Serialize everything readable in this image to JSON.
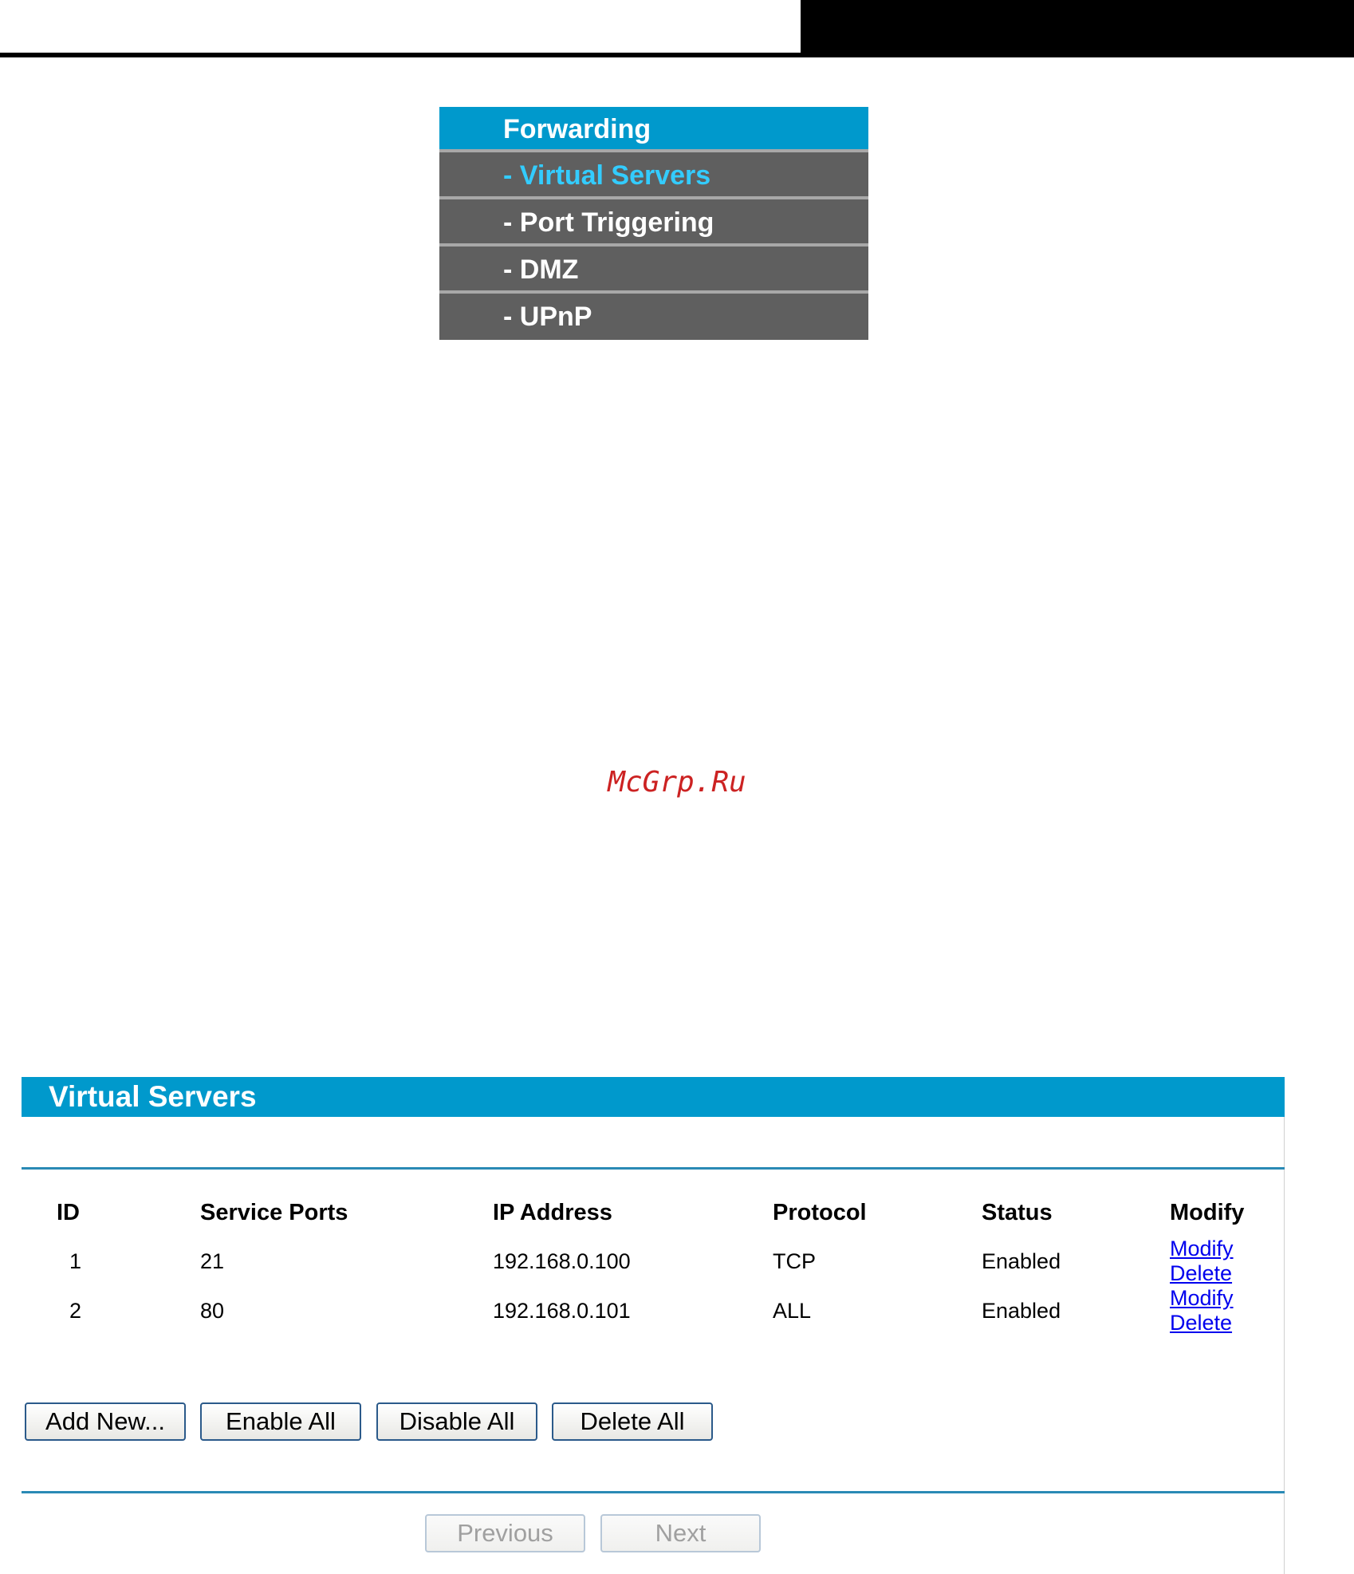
{
  "forwarding_menu": {
    "title": "Forwarding",
    "items": [
      {
        "label": "- Virtual Servers",
        "active": true
      },
      {
        "label": "- Port Triggering",
        "active": false
      },
      {
        "label": "- DMZ",
        "active": false
      },
      {
        "label": "- UPnP",
        "active": false
      }
    ]
  },
  "watermark": "McGrp.Ru",
  "virtual_servers": {
    "title": "Virtual Servers",
    "columns": [
      "ID",
      "Service Ports",
      "IP Address",
      "Protocol",
      "Status",
      "Modify"
    ],
    "rows": [
      {
        "id": "1",
        "service_ports": "21",
        "ip_address": "192.168.0.100",
        "protocol": "TCP",
        "status": "Enabled",
        "modify_label": "Modify",
        "delete_label": "Delete"
      },
      {
        "id": "2",
        "service_ports": "80",
        "ip_address": "192.168.0.101",
        "protocol": "ALL",
        "status": "Enabled",
        "modify_label": "Modify",
        "delete_label": "Delete"
      }
    ],
    "buttons": {
      "add_new": "Add New...",
      "enable_all": "Enable All",
      "disable_all": "Disable All",
      "delete_all": "Delete All"
    },
    "pagination": {
      "previous": "Previous",
      "next": "Next"
    }
  },
  "colors": {
    "accent_blue": "#0099cc",
    "menu_gray": "#5f5f5f",
    "active_item": "#33ccff",
    "link": "#0000ee",
    "watermark": "#cc2222"
  }
}
